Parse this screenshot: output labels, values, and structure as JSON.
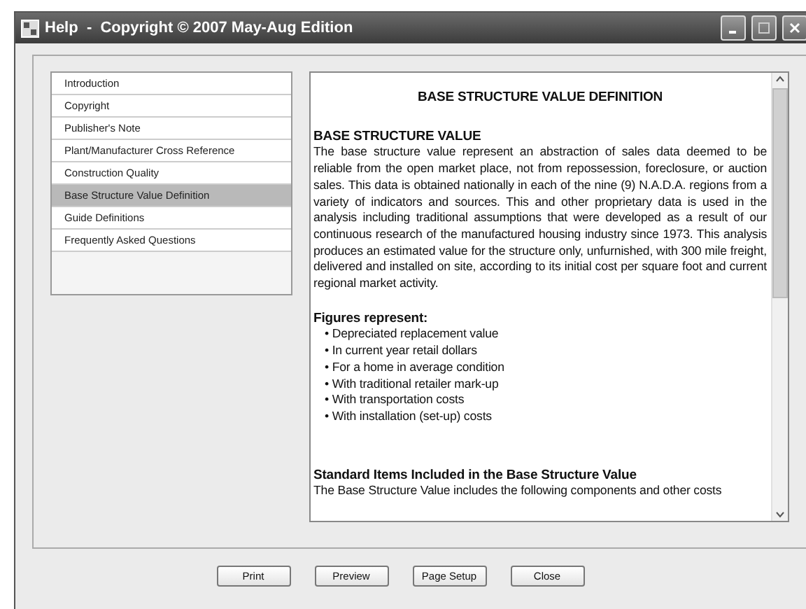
{
  "window": {
    "title": "Help  -  Copyright © 2007 May-Aug Edition"
  },
  "sidebar": {
    "items": [
      {
        "label": "Introduction",
        "selected": false
      },
      {
        "label": "Copyright",
        "selected": false
      },
      {
        "label": "Publisher's Note",
        "selected": false
      },
      {
        "label": "Plant/Manufacturer Cross Reference",
        "selected": false
      },
      {
        "label": "Construction Quality",
        "selected": false
      },
      {
        "label": "Base Structure Value Definition",
        "selected": true
      },
      {
        "label": "Guide Definitions",
        "selected": false
      },
      {
        "label": "Frequently Asked Questions",
        "selected": false
      }
    ]
  },
  "document": {
    "title": "BASE STRUCTURE VALUE DEFINITION",
    "sections": [
      {
        "heading": "BASE STRUCTURE VALUE",
        "paragraph": "The base structure value represent an abstraction of sales data deemed to be reliable from the open market place, not from repossession, foreclosure, or auction sales.  This data is obtained nationally in each of the nine (9) N.A.D.A. regions from a variety of indicators and sources.  This and other proprietary data is used in the analysis including traditional assumptions that were developed as a result of our continuous research of the manufactured housing industry since 1973.  This analysis produces an estimated value for the structure only, unfurnished, with 300 mile freight, delivered and installed on site, according to its initial cost per square foot and current regional market activity."
      },
      {
        "heading": "Figures represent:",
        "bullets": [
          "• Depreciated replacement value",
          "• In current year retail dollars",
          "• For a home in average condition",
          "• With traditional retailer mark-up",
          "• With transportation costs",
          "• With installation (set-up) costs"
        ]
      },
      {
        "heading": "Standard Items Included in the Base Structure Value",
        "paragraph": "The Base Structure Value includes the following components and other costs"
      }
    ]
  },
  "buttons": [
    "Print",
    "Preview",
    "Page Setup",
    "Close"
  ]
}
